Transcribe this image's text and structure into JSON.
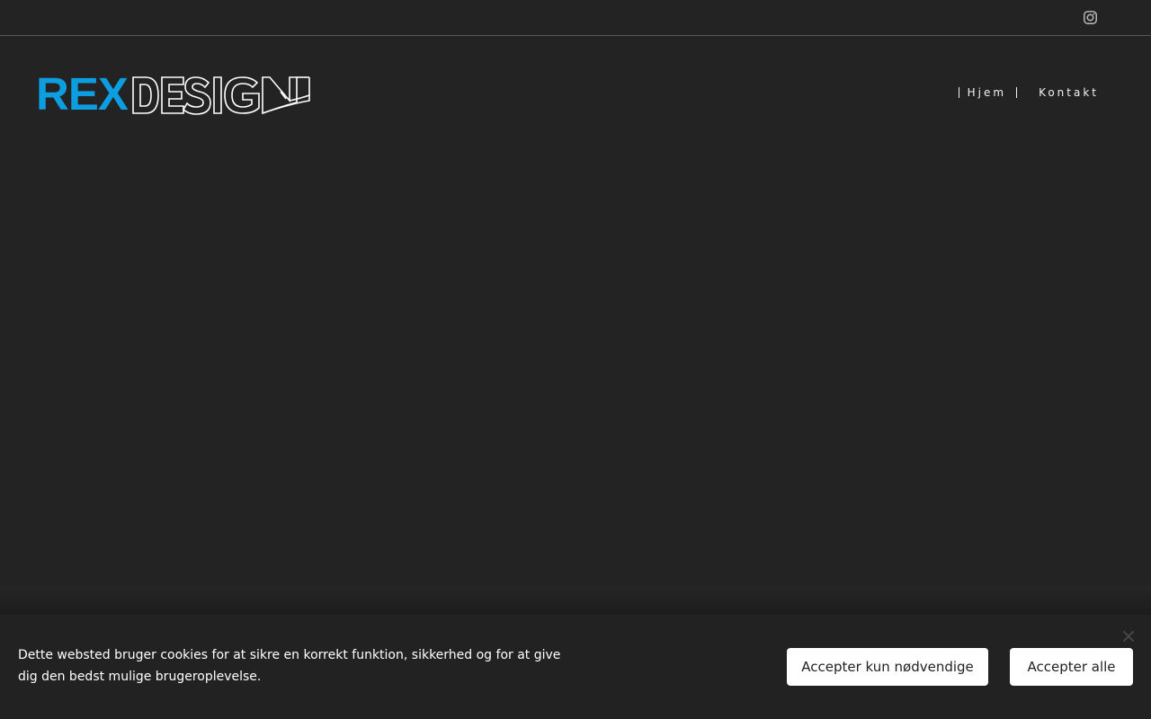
{
  "topbar": {
    "social_icon": "instagram-icon"
  },
  "logo": {
    "rex": "REX",
    "design": "DESIGN",
    "rex_color": "#0c9ee0",
    "design_color": "#ffffff"
  },
  "nav": {
    "items": [
      {
        "label": "Hjem"
      },
      {
        "label": "Kontakt"
      }
    ]
  },
  "cookie": {
    "text": "Dette websted bruger cookies for at sikre en korrekt funktion, sikkerhed og for at give dig den bedst mulige brugeroplevelse.",
    "accept_necessary_label": "Accepter kun nødvendige",
    "accept_all_label": "Accepter alle",
    "close_icon": "close-icon"
  },
  "colors": {
    "background": "#232323",
    "accent": "#0c9ee0"
  }
}
